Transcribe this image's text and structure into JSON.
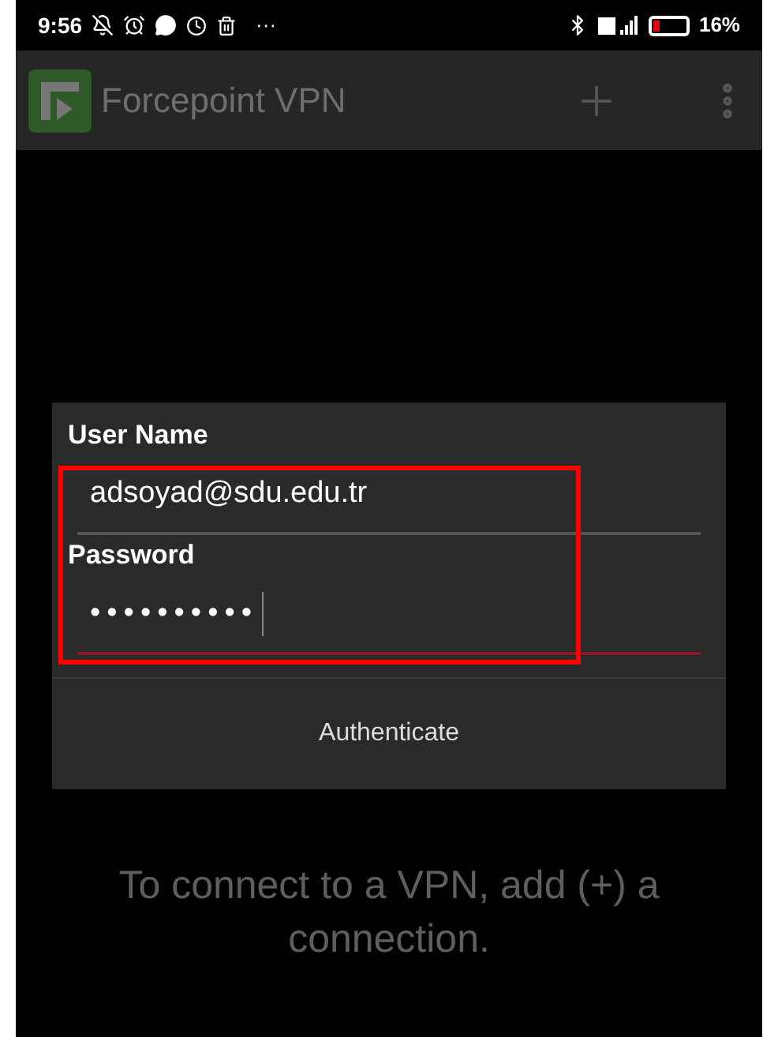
{
  "status_bar": {
    "time": "9:56",
    "more": "···",
    "battery_text": "16%"
  },
  "app_bar": {
    "title": "Forcepoint VPN"
  },
  "dialog": {
    "fields": [
      {
        "label": "User Name",
        "value": "adsoyad@sdu.edu.tr",
        "focused": false
      },
      {
        "label": "Password",
        "value": "••••••••••",
        "focused": true
      }
    ],
    "highlighted": true,
    "button": "Authenticate"
  },
  "empty_message": "To connect to a VPN, add (+) a connection."
}
